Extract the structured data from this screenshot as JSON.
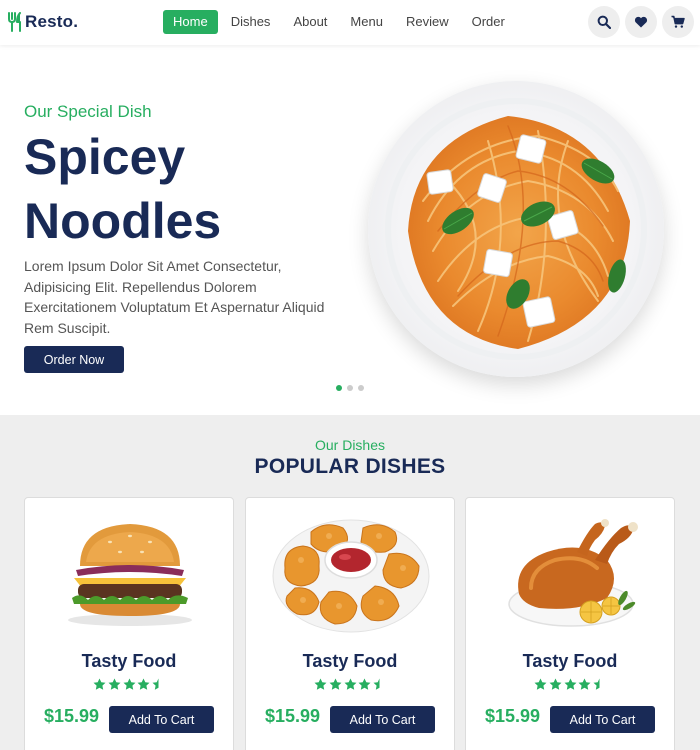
{
  "header": {
    "logo_text": "Resto.",
    "nav": [
      "Home",
      "Dishes",
      "About",
      "Menu",
      "Review",
      "Order"
    ],
    "active_nav": "Home",
    "icons": [
      "search-icon",
      "heart-icon",
      "cart-icon"
    ]
  },
  "hero": {
    "subtitle": "Our Special Dish",
    "title_line1": "Spicey",
    "title_line2": "Noodles",
    "description": "Lorem Ipsum Dolor Sit Amet Consectetur, Adipisicing Elit. Repellendus Dolorem Exercitationem Voluptatum Et Aspernatur Aliquid Rem Suscipit.",
    "button": "Order Now",
    "slide_count": 3,
    "active_slide": 1
  },
  "dishes": {
    "subtitle": "Our Dishes",
    "title": "POPULAR DISHES",
    "items": [
      {
        "name": "Tasty Food",
        "price": "$15.99",
        "rating": 4.5,
        "button": "Add To Cart",
        "image": "burger"
      },
      {
        "name": "Tasty Food",
        "price": "$15.99",
        "rating": 4.5,
        "button": "Add To Cart",
        "image": "chicken-nuggets"
      },
      {
        "name": "Tasty Food",
        "price": "$15.99",
        "rating": 4.5,
        "button": "Add To Cart",
        "image": "roast-chicken"
      }
    ]
  },
  "colors": {
    "primary": "#27ae60",
    "navy": "#192a56",
    "background": "#eeeeee"
  }
}
